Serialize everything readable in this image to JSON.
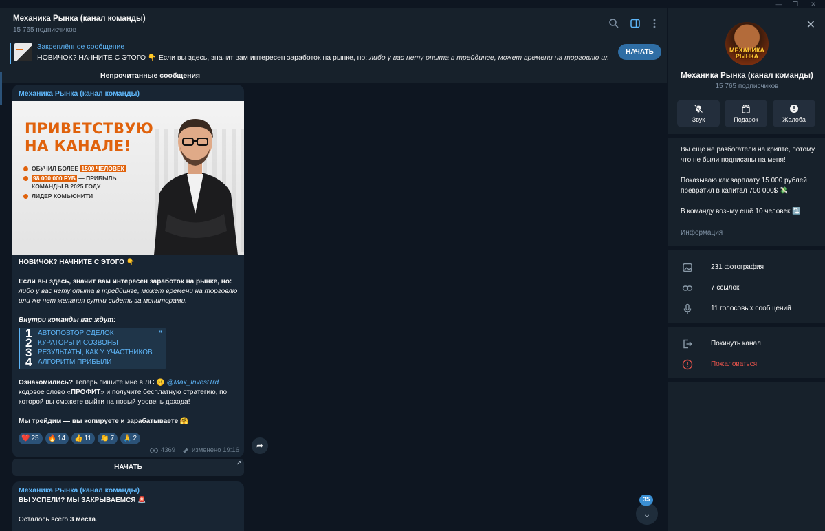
{
  "chat": {
    "title": "Механика Рынка (канал команды)",
    "subscribers": "15 765 подписчиков"
  },
  "pinned": {
    "label": "Закреплённое сообщение",
    "text_bold": "НОВИЧОК? НАЧНИТЕ С ЭТОГО 👇",
    "text_rest": "Если вы здесь, значит вам интересен заработок на рынке, но:",
    "text_italic": "либо у вас нету опыта в трейдинге, может времени на торговлю или ...",
    "button": "НАЧАТЬ"
  },
  "unread_divider": "Непрочитанные сообщения",
  "message": {
    "author": "Механика Рынка (канал команды)",
    "banner": {
      "title_line1": "ПРИВЕТСТВУЮ",
      "title_line2": "НА КАНАЛЕ!",
      "b1_pre": "ОБУЧИЛ БОЛЕЕ ",
      "b1_hl": "1500 ЧЕЛОВЕК",
      "b2_hl": "98 000 000 РУБ",
      "b2_post": " — ПРИБЫЛЬ КОМАНДЫ В 2025 ГОДУ",
      "b3": "ЛИДЕР КОМЬЮНИТИ"
    },
    "headline": "НОВИЧОК? НАЧНИТЕ С ЭТОГО 👇",
    "p1_bold": "Если вы здесь, значит вам интересен заработок на рынке, но:",
    "p1_italic": "либо у вас нету опыта в трейдинге, может времени на торговлю или же нет желания сутки сидеть за мониторами.",
    "inside": "Внутри команды вас ждут:",
    "list": [
      {
        "num": "1",
        "text": "АВТОПОВТОР СДЕЛОК"
      },
      {
        "num": "2",
        "text": "КУРАТОРЫ И СОЗВОНЫ"
      },
      {
        "num": "3",
        "text": "РЕЗУЛЬТАТЫ, КАК У УЧАСТНИКОВ"
      },
      {
        "num": "4",
        "text": "АЛГОРИТМ ПРИБЫЛИ"
      }
    ],
    "p2_bold": "Ознакомились?",
    "p2_a": " Теперь пишите мне в ЛС 🤫 ",
    "p2_mention": "@Max_InvestTrd",
    "p2_b": " кодовое слово «",
    "p2_code": "ПРОФИТ",
    "p2_c": "» и получите бесплатную стратегию, по которой вы сможете выйти на новый уровень дохода!",
    "closing": "Мы трейдим — вы копируете  и зарабатываете 🤗",
    "reactions": [
      {
        "emoji": "❤️",
        "count": "25"
      },
      {
        "emoji": "🔥",
        "count": "14"
      },
      {
        "emoji": "👍",
        "count": "11"
      },
      {
        "emoji": "👏",
        "count": "7"
      },
      {
        "emoji": "🙏",
        "count": "2"
      }
    ],
    "views": "4369",
    "edited": "изменено 19:16",
    "button": "НАЧАТЬ"
  },
  "message2": {
    "author": "Механика Рынка (канал команды)",
    "line1": "ВЫ УСПЕЛИ? МЫ ЗАКРЫВАЕМСЯ 🚨",
    "line2_pre": "Осталось всего ",
    "line2_bold": "3 места",
    "line2_post": "."
  },
  "unread_count": "35",
  "sidebar": {
    "avatar_text_1": "МЕХАНИКА",
    "avatar_text_2": "РЫНКА",
    "title": "Механика Рынка (канал команды)",
    "subscribers": "15 765 подписчиков",
    "actions": [
      {
        "label": "Звук",
        "icon": "bell-off-icon"
      },
      {
        "label": "Подарок",
        "icon": "gift-icon"
      },
      {
        "label": "Жалоба",
        "icon": "alert-icon"
      }
    ],
    "desc1": "Вы еще не разбогатели на крипте, потому что не были подписаны на меня!",
    "desc2": "Показываю как зарплату 15 000 рублей превратил в капитал 700 000$ 💸",
    "desc3": "В команду возьму ещё 10 человек ⤵️",
    "info_label": "Информация",
    "media": [
      {
        "label": "231 фотография",
        "icon": "photo-icon"
      },
      {
        "label": "7 ссылок",
        "icon": "link-icon"
      },
      {
        "label": "11 голосовых сообщений",
        "icon": "mic-icon"
      }
    ],
    "leave": "Покинуть канал",
    "report": "Пожаловаться"
  }
}
